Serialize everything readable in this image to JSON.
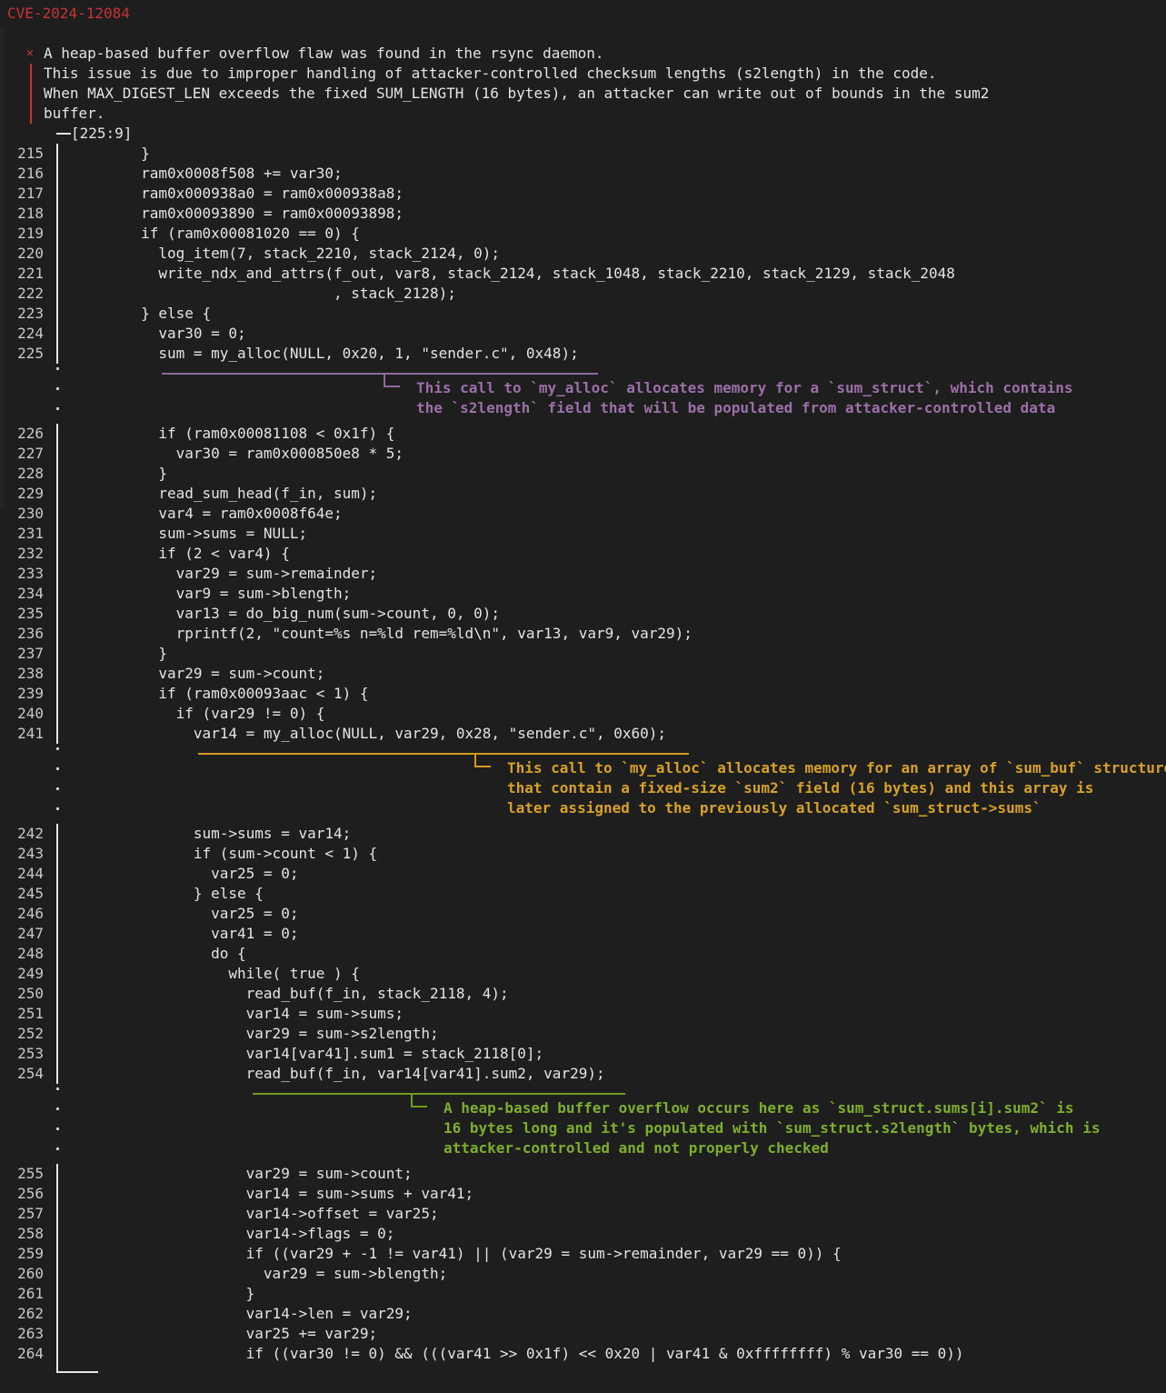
{
  "header": {
    "cve_id": "CVE-2024-12084"
  },
  "issue": {
    "icon": "close-icon",
    "lines": [
      "A heap-based buffer overflow flaw was found in the rsync daemon.",
      "This issue is due to improper handling of attacker-controlled checksum lengths (s2length) in the code.",
      "When MAX_DIGEST_LEN exceeds the fixed SUM_LENGTH (16 bytes), an attacker can write out of bounds in the sum2",
      "buffer."
    ]
  },
  "range_label": "[225:9]",
  "code_lines": [
    {
      "n": "215",
      "t": "        }"
    },
    {
      "n": "216",
      "t": "        ram0x0008f508 += var30;"
    },
    {
      "n": "217",
      "t": "        ram0x000938a0 = ram0x000938a8;"
    },
    {
      "n": "218",
      "t": "        ram0x00093890 = ram0x00093898;"
    },
    {
      "n": "219",
      "t": "        if (ram0x00081020 == 0) {"
    },
    {
      "n": "220",
      "t": "          log_item(7, stack_2210, stack_2124, 0);"
    },
    {
      "n": "221",
      "t": "          write_ndx_and_attrs(f_out, var8, stack_2124, stack_1048, stack_2210, stack_2129, stack_2048"
    },
    {
      "n": "222",
      "t": "                              , stack_2128);"
    },
    {
      "n": "223",
      "t": "        } else {"
    },
    {
      "n": "224",
      "t": "          var30 = 0;"
    },
    {
      "n": "225",
      "t": "          sum = my_alloc(NULL, 0x20, 1, \"sender.c\", 0x48);"
    },
    {
      "n": "226",
      "t": "          if (ram0x00081108 < 0x1f) {"
    },
    {
      "n": "227",
      "t": "            var30 = ram0x000850e8 * 5;"
    },
    {
      "n": "228",
      "t": "          }"
    },
    {
      "n": "229",
      "t": "          read_sum_head(f_in, sum);"
    },
    {
      "n": "230",
      "t": "          var4 = ram0x0008f64e;"
    },
    {
      "n": "231",
      "t": "          sum->sums = NULL;"
    },
    {
      "n": "232",
      "t": "          if (2 < var4) {"
    },
    {
      "n": "233",
      "t": "            var29 = sum->remainder;"
    },
    {
      "n": "234",
      "t": "            var9 = sum->blength;"
    },
    {
      "n": "235",
      "t": "            var13 = do_big_num(sum->count, 0, 0);"
    },
    {
      "n": "236",
      "t": "            rprintf(2, \"count=%s n=%ld rem=%ld\\n\", var13, var9, var29);"
    },
    {
      "n": "237",
      "t": "          }"
    },
    {
      "n": "238",
      "t": "          var29 = sum->count;"
    },
    {
      "n": "239",
      "t": "          if (ram0x00093aac < 1) {"
    },
    {
      "n": "240",
      "t": "            if (var29 != 0) {"
    },
    {
      "n": "241",
      "t": "              var14 = my_alloc(NULL, var29, 0x28, \"sender.c\", 0x60);"
    },
    {
      "n": "242",
      "t": "              sum->sums = var14;"
    },
    {
      "n": "243",
      "t": "              if (sum->count < 1) {"
    },
    {
      "n": "244",
      "t": "                var25 = 0;"
    },
    {
      "n": "245",
      "t": "              } else {"
    },
    {
      "n": "246",
      "t": "                var25 = 0;"
    },
    {
      "n": "247",
      "t": "                var41 = 0;"
    },
    {
      "n": "248",
      "t": "                do {"
    },
    {
      "n": "249",
      "t": "                  while( true ) {"
    },
    {
      "n": "250",
      "t": "                    read_buf(f_in, stack_2118, 4);"
    },
    {
      "n": "251",
      "t": "                    var14 = sum->sums;"
    },
    {
      "n": "252",
      "t": "                    var29 = sum->s2length;"
    },
    {
      "n": "253",
      "t": "                    var14[var41].sum1 = stack_2118[0];"
    },
    {
      "n": "254",
      "t": "                    read_buf(f_in, var14[var41].sum2, var29);"
    },
    {
      "n": "255",
      "t": "                    var29 = sum->count;"
    },
    {
      "n": "256",
      "t": "                    var14 = sum->sums + var41;"
    },
    {
      "n": "257",
      "t": "                    var14->offset = var25;"
    },
    {
      "n": "258",
      "t": "                    var14->flags = 0;"
    },
    {
      "n": "259",
      "t": "                    if ((var29 + -1 != var41) || (var29 = sum->remainder, var29 == 0)) {"
    },
    {
      "n": "260",
      "t": "                      var29 = sum->blength;"
    },
    {
      "n": "261",
      "t": "                    }"
    },
    {
      "n": "262",
      "t": "                    var14->len = var29;"
    },
    {
      "n": "263",
      "t": "                    var25 += var29;"
    },
    {
      "n": "264",
      "t": "                    if ((var30 != 0) && (((var41 >> 0x1f) << 0x20 | var41 & 0xffffffff) % var30 == 0))"
    }
  ],
  "annotations": [
    {
      "after_line": "225",
      "color": "#9c6fa8",
      "lines": [
        "This call to `my_alloc` allocates memory for a `sum_struct`, which contains",
        "the `s2length` field that will be populated from attacker-controlled data"
      ]
    },
    {
      "after_line": "241",
      "color": "#d7a128",
      "lines": [
        "This call to `my_alloc` allocates memory for an array of `sum_buf` structures",
        "that contain a fixed-size `sum2` field (16 bytes) and this array is",
        "later assigned to the previously allocated `sum_struct->sums`"
      ]
    },
    {
      "after_line": "254",
      "color": "#7fae2e",
      "lines": [
        "A heap-based buffer overflow occurs here as `sum_struct.sums[i].sum2` is",
        "16 bytes long and it's populated with `sum_struct.s2length` bytes, which is",
        "attacker-controlled and not properly checked"
      ]
    }
  ]
}
